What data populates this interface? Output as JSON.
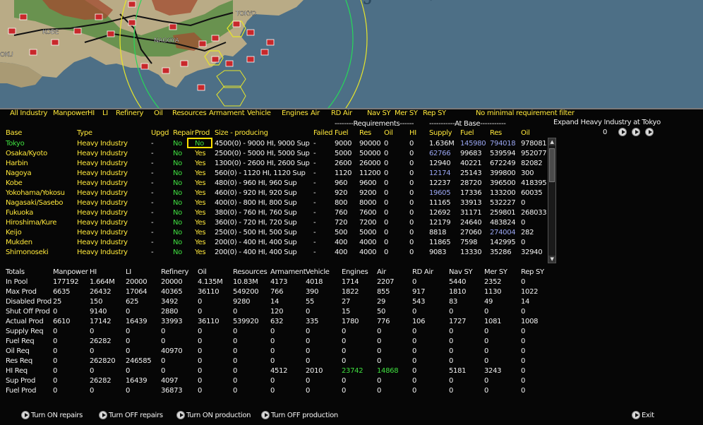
{
  "map": {
    "labels": [
      "KOBE",
      "TOKYO",
      "NAGOYA",
      "OKU",
      "JAPAN"
    ]
  },
  "filters": [
    "All Industry",
    "Manpower",
    "HI",
    "LI",
    "Refinery",
    "Oil",
    "Resources",
    "Armament",
    "Vehicle",
    "Engines",
    "Air",
    "RD Air",
    "Nav SY",
    "Mer SY",
    "Rep SY",
    "No minimal requirement filter"
  ],
  "expand": {
    "label": "Expand Heavy Industry at Tokyo",
    "value": "0"
  },
  "group_headers": {
    "requirements": "--------Requirements------",
    "atbase": "-----------At Base-----------"
  },
  "columns": [
    "Base",
    "Type",
    "Upgd",
    "Repair",
    "Prod",
    "Size - producing",
    "Failed",
    "Fuel",
    "Res",
    "Oil",
    "HI",
    "Supply",
    "Fuel",
    "Res",
    "Oil"
  ],
  "rows": [
    {
      "base": "Tokyo",
      "type": "Heavy Industry",
      "upgd": "-",
      "repair": "No",
      "prod": "No",
      "size": "4500(0) - 9000 HI, 9000 Sup",
      "failed": "-",
      "rfuel": "9000",
      "rres": "90000",
      "roil": "0",
      "rhi": "0",
      "supply": "1.636M",
      "afuel": "145980",
      "ares": "794018",
      "aoil": "978081"
    },
    {
      "base": "Osaka/Kyoto",
      "type": "Heavy Industry",
      "upgd": "-",
      "repair": "No",
      "prod": "Yes",
      "size": "2500(0) - 5000 HI, 5000 Sup",
      "failed": "-",
      "rfuel": "5000",
      "rres": "50000",
      "roil": "0",
      "rhi": "0",
      "supply": "62766",
      "afuel": "99683",
      "ares": "539594",
      "aoil": "952077"
    },
    {
      "base": "Harbin",
      "type": "Heavy Industry",
      "upgd": "-",
      "repair": "No",
      "prod": "Yes",
      "size": "1300(0) - 2600 HI, 2600 Sup",
      "failed": "-",
      "rfuel": "2600",
      "rres": "26000",
      "roil": "0",
      "rhi": "0",
      "supply": "12940",
      "afuel": "40221",
      "ares": "672249",
      "aoil": "82082"
    },
    {
      "base": "Nagoya",
      "type": "Heavy Industry",
      "upgd": "-",
      "repair": "No",
      "prod": "Yes",
      "size": "560(0) - 1120 HI, 1120 Sup",
      "failed": "-",
      "rfuel": "1120",
      "rres": "11200",
      "roil": "0",
      "rhi": "0",
      "supply": "12174",
      "afuel": "25143",
      "ares": "399800",
      "aoil": "300"
    },
    {
      "base": "Kobe",
      "type": "Heavy Industry",
      "upgd": "-",
      "repair": "No",
      "prod": "Yes",
      "size": "480(0) - 960 HI, 960 Sup",
      "failed": "-",
      "rfuel": "960",
      "rres": "9600",
      "roil": "0",
      "rhi": "0",
      "supply": "12237",
      "afuel": "28720",
      "ares": "396500",
      "aoil": "418395"
    },
    {
      "base": "Yokohama/Yokosu",
      "type": "Heavy Industry",
      "upgd": "-",
      "repair": "No",
      "prod": "Yes",
      "size": "460(0) - 920 HI, 920 Sup",
      "failed": "-",
      "rfuel": "920",
      "rres": "9200",
      "roil": "0",
      "rhi": "0",
      "supply": "19605",
      "afuel": "17336",
      "ares": "133200",
      "aoil": "60035"
    },
    {
      "base": "Nagasaki/Sasebo",
      "type": "Heavy Industry",
      "upgd": "-",
      "repair": "No",
      "prod": "Yes",
      "size": "400(0) - 800 HI, 800 Sup",
      "failed": "-",
      "rfuel": "800",
      "rres": "8000",
      "roil": "0",
      "rhi": "0",
      "supply": "11165",
      "afuel": "33913",
      "ares": "532227",
      "aoil": "0"
    },
    {
      "base": "Fukuoka",
      "type": "Heavy Industry",
      "upgd": "-",
      "repair": "No",
      "prod": "Yes",
      "size": "380(0) - 760 HI, 760 Sup",
      "failed": "-",
      "rfuel": "760",
      "rres": "7600",
      "roil": "0",
      "rhi": "0",
      "supply": "12692",
      "afuel": "31171",
      "ares": "259801",
      "aoil": "268033"
    },
    {
      "base": "Hiroshima/Kure",
      "type": "Heavy Industry",
      "upgd": "-",
      "repair": "No",
      "prod": "Yes",
      "size": "360(0) - 720 HI, 720 Sup",
      "failed": "-",
      "rfuel": "720",
      "rres": "7200",
      "roil": "0",
      "rhi": "0",
      "supply": "12179",
      "afuel": "24640",
      "ares": "483824",
      "aoil": "0"
    },
    {
      "base": "Keijo",
      "type": "Heavy Industry",
      "upgd": "-",
      "repair": "No",
      "prod": "Yes",
      "size": "250(0) - 500 HI, 500 Sup",
      "failed": "-",
      "rfuel": "500",
      "rres": "5000",
      "roil": "0",
      "rhi": "0",
      "supply": "8818",
      "afuel": "27060",
      "ares": "274004",
      "aoil": "282"
    },
    {
      "base": "Mukden",
      "type": "Heavy Industry",
      "upgd": "-",
      "repair": "No",
      "prod": "Yes",
      "size": "200(0) - 400 HI, 400 Sup",
      "failed": "-",
      "rfuel": "400",
      "rres": "4000",
      "roil": "0",
      "rhi": "0",
      "supply": "11865",
      "afuel": "7598",
      "ares": "142995",
      "aoil": "0"
    },
    {
      "base": "Shimonoseki",
      "type": "Heavy Industry",
      "upgd": "-",
      "repair": "No",
      "prod": "Yes",
      "size": "200(0) - 400 HI, 400 Sup",
      "failed": "-",
      "rfuel": "400",
      "rres": "4000",
      "roil": "0",
      "rhi": "0",
      "supply": "9083",
      "afuel": "13330",
      "ares": "35286",
      "aoil": "32940"
    }
  ],
  "totals": {
    "headers": [
      "Totals",
      "Manpower",
      "HI",
      "LI",
      "Refinery",
      "Oil",
      "Resources",
      "Armament",
      "Vehicle",
      "Engines",
      "Air",
      "RD Air",
      "Nav SY",
      "Mer SY",
      "Rep SY"
    ],
    "rows": [
      {
        "label": "In Pool",
        "values": [
          "177192",
          "1.664M",
          "20000",
          "20000",
          "4.135M",
          "10.83M",
          "4173",
          "4018",
          "1714",
          "2207",
          "0",
          "5440",
          "2352",
          "0"
        ]
      },
      {
        "label": "Max Prod",
        "values": [
          "6635",
          "26432",
          "17064",
          "40365",
          "36110",
          "549200",
          "766",
          "390",
          "1822",
          "855",
          "917",
          "1810",
          "1130",
          "1022"
        ]
      },
      {
        "label": "Disabled Prod",
        "values": [
          "25",
          "150",
          "625",
          "3492",
          "0",
          "9280",
          "14",
          "55",
          "27",
          "29",
          "543",
          "83",
          "49",
          "14"
        ]
      },
      {
        "label": "Shut Off Prod",
        "values": [
          "0",
          "9140",
          "0",
          "2880",
          "0",
          "0",
          "120",
          "0",
          "15",
          "50",
          "0",
          "0",
          "0",
          "0"
        ]
      },
      {
        "label": "Actual Prod",
        "values": [
          "6610",
          "17142",
          "16439",
          "33993",
          "36110",
          "539920",
          "632",
          "335",
          "1780",
          "776",
          "106",
          "1727",
          "1081",
          "1008"
        ]
      },
      {
        "label": "Supply Req",
        "values": [
          "0",
          "0",
          "0",
          "0",
          "0",
          "0",
          "0",
          "0",
          "0",
          "0",
          "0",
          "0",
          "0",
          "0"
        ]
      },
      {
        "label": "Fuel Req",
        "values": [
          "0",
          "26282",
          "0",
          "0",
          "0",
          "0",
          "0",
          "0",
          "0",
          "0",
          "0",
          "0",
          "0",
          "0"
        ]
      },
      {
        "label": "Oil Req",
        "values": [
          "0",
          "0",
          "0",
          "40970",
          "0",
          "0",
          "0",
          "0",
          "0",
          "0",
          "0",
          "0",
          "0",
          "0"
        ]
      },
      {
        "label": "Res Req",
        "values": [
          "0",
          "262820",
          "246585",
          "0",
          "0",
          "0",
          "0",
          "0",
          "0",
          "0",
          "0",
          "0",
          "0",
          "0"
        ]
      },
      {
        "label": "HI Req",
        "values": [
          "0",
          "0",
          "0",
          "0",
          "0",
          "0",
          "4512",
          "2010",
          "23742",
          "14868",
          "0",
          "5181",
          "3243",
          "0"
        ]
      },
      {
        "label": "Sup Prod",
        "values": [
          "0",
          "26282",
          "16439",
          "4097",
          "0",
          "0",
          "0",
          "0",
          "0",
          "0",
          "0",
          "0",
          "0",
          "0"
        ]
      },
      {
        "label": "Fuel Prod",
        "values": [
          "0",
          "0",
          "0",
          "36873",
          "0",
          "0",
          "0",
          "0",
          "0",
          "0",
          "0",
          "0",
          "0",
          "0"
        ]
      }
    ]
  },
  "actions": [
    "Turn ON repairs",
    "Turn OFF repairs",
    "Turn ON production",
    "Turn OFF production"
  ],
  "exit_label": "Exit",
  "colors": {
    "yellow": "#ffe83a",
    "green": "#3fe03f",
    "blue_highlight": "#9aa6f2",
    "white": "#f2f2f2",
    "selection_box": "#ffe000"
  }
}
